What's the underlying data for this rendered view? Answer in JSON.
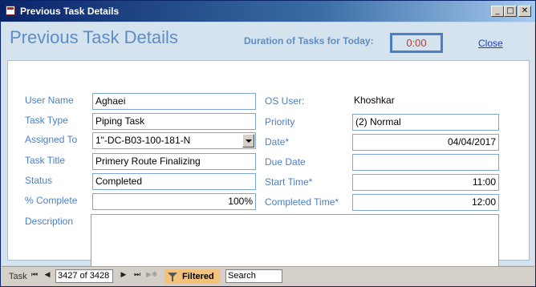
{
  "window": {
    "title": "Previous Task Details"
  },
  "header": {
    "title": "Previous Task Details",
    "duration_label": "Duration of Tasks for Today:",
    "duration_value": "0:00",
    "close_label": "Close"
  },
  "form": {
    "user_name": {
      "label": "User Name",
      "value": "Aghaei"
    },
    "task_type": {
      "label": "Task Type",
      "value": "Piping Task"
    },
    "assigned_to": {
      "label": "Assigned To",
      "value": "1\"-DC-B03-100-181-N"
    },
    "task_title": {
      "label": "Task Title",
      "value": "Primery Route Finalizing"
    },
    "status": {
      "label": "Status",
      "value": "Completed"
    },
    "percent_complete": {
      "label": "% Complete",
      "value": "100%"
    },
    "description": {
      "label": "Description",
      "value": ""
    },
    "os_user": {
      "label": "OS User:",
      "value": "Khoshkar"
    },
    "priority": {
      "label": "Priority",
      "value": "(2) Normal"
    },
    "date": {
      "label": "Date*",
      "value": "04/04/2017"
    },
    "due_date": {
      "label": "Due Date",
      "value": ""
    },
    "start_time": {
      "label": "Start Time*",
      "value": "11:00"
    },
    "completed_time": {
      "label": "Completed Time*",
      "value": "12:00"
    }
  },
  "navigation": {
    "record_label": "Task",
    "current_record": "3427 of 3428",
    "filter_label": "Filtered",
    "search_placeholder": "Search"
  }
}
